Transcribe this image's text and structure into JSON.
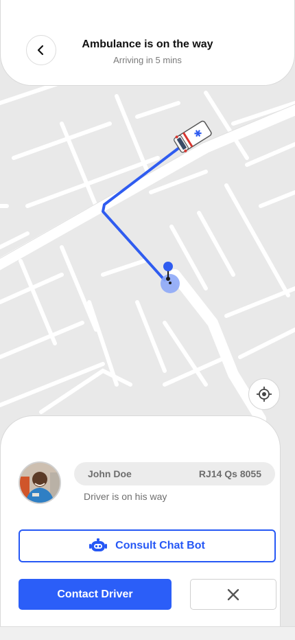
{
  "header": {
    "title": "Ambulance is on the way",
    "subtitle": "Arriving in 5 mins"
  },
  "icons": {
    "back": "chevron-left-icon",
    "locate": "crosshair-icon",
    "chatbot": "robot-icon",
    "close": "close-icon",
    "ambulance": "ambulance-icon",
    "destination": "location-pin-icon"
  },
  "driver": {
    "name": "John Doe",
    "plate": "RJ14 Qs 8055",
    "status": "Driver is on his way"
  },
  "actions": {
    "chat_label": "Consult Chat Bot",
    "contact_label": "Contact Driver"
  },
  "colors": {
    "accent": "#2b5ef8",
    "route": "#2f5cf0",
    "map_bg": "#e9e9e9"
  }
}
